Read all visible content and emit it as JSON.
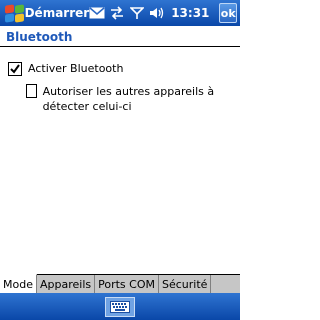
{
  "titlebar": {
    "app_title": "Démarrer",
    "time": "13:31",
    "ok_label": "ok",
    "icons": [
      "mail-icon",
      "sync-icon",
      "signal-icon",
      "volume-icon"
    ]
  },
  "header": {
    "title": "Bluetooth"
  },
  "options": {
    "enable_bt": {
      "label": "Activer Bluetooth",
      "checked": true
    },
    "discoverable": {
      "label": "Autoriser les autres appareils à détecter celui-ci",
      "checked": false
    }
  },
  "tabs": [
    {
      "label": "Mode",
      "active": true
    },
    {
      "label": "Appareils",
      "active": false
    },
    {
      "label": "Ports COM",
      "active": false
    },
    {
      "label": "Sécurité",
      "active": false
    }
  ],
  "softbar": {
    "icon": "keyboard-icon"
  },
  "colors": {
    "titlebar": "#0a47a8",
    "header_text": "#1f59b9"
  }
}
